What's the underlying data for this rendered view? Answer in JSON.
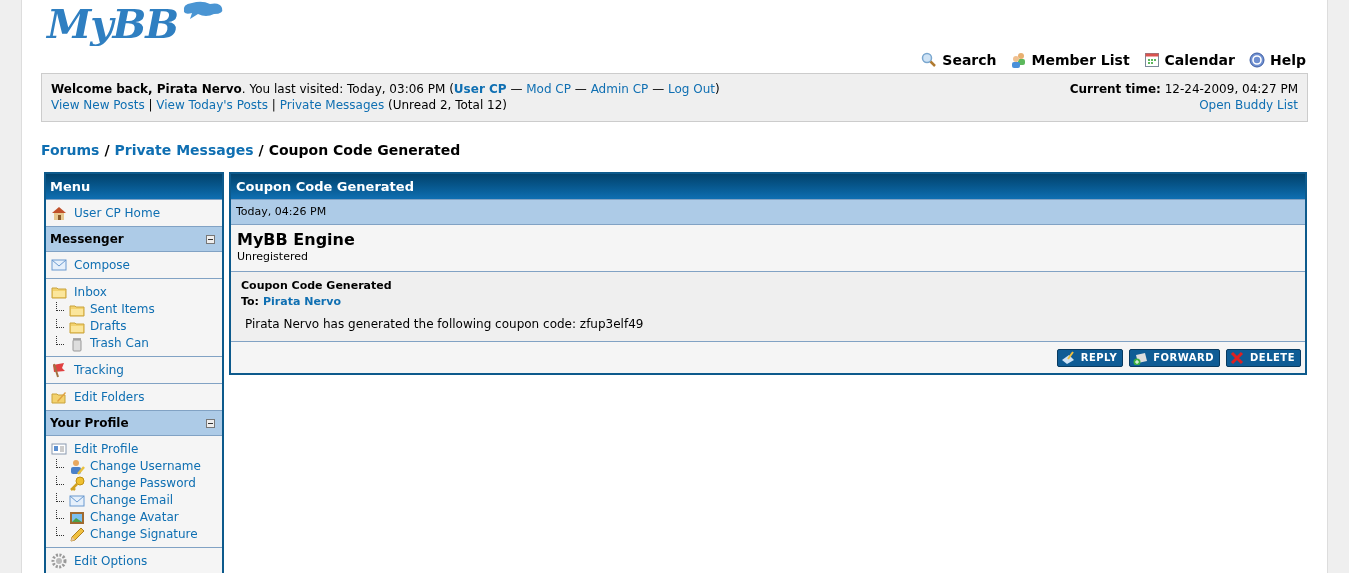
{
  "logo": "MyBB",
  "top_links": [
    {
      "label": "Search"
    },
    {
      "label": "Member List"
    },
    {
      "label": "Calendar"
    },
    {
      "label": "Help"
    }
  ],
  "welcome": {
    "line_1": [
      {
        "kind": "text",
        "text": "**Welcome back, Pirata Nervo**. You last visited: Today, 03:06 PM ("
      },
      {
        "kind": "link",
        "text": "User CP",
        "bold": true
      },
      {
        "kind": "text",
        "text": " — "
      },
      {
        "kind": "link",
        "text": "Mod CP",
        "bold": false
      },
      {
        "kind": "text",
        "text": " — "
      },
      {
        "kind": "link",
        "text": "Admin CP",
        "bold": false
      },
      {
        "kind": "text",
        "text": " — "
      },
      {
        "kind": "link",
        "text": "Log Out",
        "bold": false
      },
      {
        "kind": "text",
        "text": ")"
      }
    ],
    "line_2": [
      {
        "kind": "link",
        "text": "View New Posts",
        "bold": false
      },
      {
        "kind": "text",
        "text": " | "
      },
      {
        "kind": "link",
        "text": "View Today's Posts",
        "bold": false
      },
      {
        "kind": "text",
        "text": " | "
      },
      {
        "kind": "link",
        "text": "Private Messages",
        "bold": false
      },
      {
        "kind": "text",
        "text": " (Unread 2, Total 12)"
      }
    ],
    "current_time": "**Current time:** 12-24-2009, 04:27 PM",
    "buddy_link": "Open Buddy List"
  },
  "breadcrumb": {
    "separator": "/",
    "items": [
      {
        "label": "Forums",
        "kind": "link"
      },
      {
        "label": "Private Messages",
        "kind": "link"
      },
      {
        "label": "Coupon Code Generated",
        "kind": "current"
      }
    ]
  },
  "sidebar": {
    "title": "Menu",
    "sections": [
      {
        "kind": "group",
        "items": [
          {
            "label": "User CP Home"
          }
        ]
      },
      {
        "kind": "header",
        "title": "Messenger",
        "expanded": true
      },
      {
        "kind": "group",
        "items": [
          {
            "label": "Compose"
          }
        ]
      },
      {
        "kind": "group",
        "items": [
          {
            "label": "Inbox",
            "children": [
              {
                "label": "Sent Items"
              },
              {
                "label": "Drafts"
              },
              {
                "label": "Trash Can"
              }
            ]
          }
        ]
      },
      {
        "kind": "group",
        "items": [
          {
            "label": "Tracking"
          }
        ]
      },
      {
        "kind": "group",
        "items": [
          {
            "label": "Edit Folders"
          }
        ]
      },
      {
        "kind": "header",
        "title": "Your Profile",
        "expanded": true
      },
      {
        "kind": "group",
        "items": [
          {
            "label": "Edit Profile",
            "children": [
              {
                "label": "Change Username"
              },
              {
                "label": "Change Password"
              },
              {
                "label": "Change Email"
              },
              {
                "label": "Change Avatar"
              },
              {
                "label": "Change Signature"
              }
            ]
          }
        ]
      },
      {
        "kind": "group",
        "items": [
          {
            "label": "Edit Options"
          }
        ]
      }
    ]
  },
  "message": {
    "title": "Coupon Code Generated",
    "date": "Today, 04:26 PM",
    "author": "MyBB Engine",
    "author_status": "Unregistered",
    "subject": "Coupon Code Generated",
    "to_label": "To:",
    "recipient": "Pirata Nervo",
    "body": "Pirata Nervo has generated the following coupon code: zfup3elf49",
    "buttons": [
      {
        "label": "REPLY"
      },
      {
        "label": "FORWARD"
      },
      {
        "label": "DELETE"
      }
    ]
  }
}
